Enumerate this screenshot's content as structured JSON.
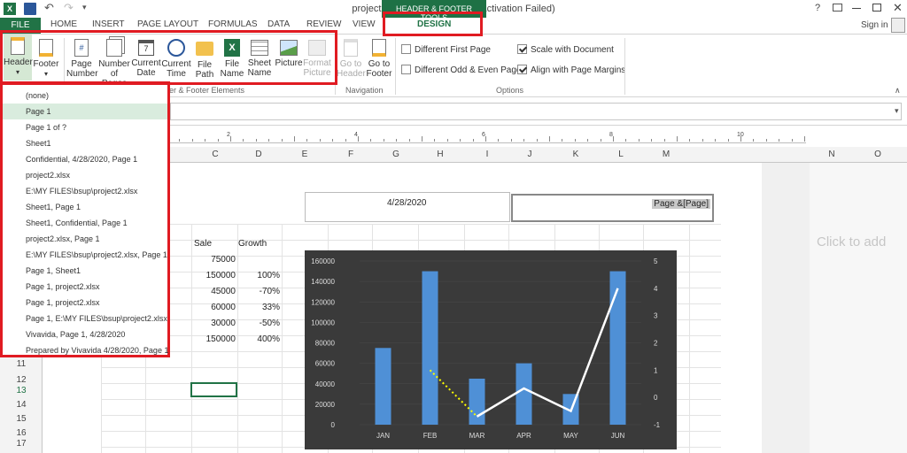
{
  "window": {
    "title": "project2.xlsx - Excel (Product Activation Failed)",
    "context_tools": "HEADER & FOOTER TOOLS",
    "help": "?",
    "sign_in": "Sign in"
  },
  "tabs": [
    "FILE",
    "HOME",
    "INSERT",
    "PAGE LAYOUT",
    "FORMULAS",
    "DATA",
    "REVIEW",
    "VIEW",
    "DESIGN"
  ],
  "ribbon": {
    "header_footer_group": {
      "header": "Header",
      "footer": "Footer"
    },
    "elements_group": {
      "label": "Header & Footer Elements",
      "buttons": [
        {
          "line1": "Page",
          "line2": "Number",
          "icon": "page-number-icon"
        },
        {
          "line1": "Number",
          "line2": "of Pages",
          "icon": "number-of-pages-icon"
        },
        {
          "line1": "Current",
          "line2": "Date",
          "icon": "calendar-icon"
        },
        {
          "line1": "Current",
          "line2": "Time",
          "icon": "clock-icon"
        },
        {
          "line1": "File",
          "line2": "Path",
          "icon": "folder-icon"
        },
        {
          "line1": "File",
          "line2": "Name",
          "icon": "excel-file-icon"
        },
        {
          "line1": "Sheet",
          "line2": "Name",
          "icon": "sheet-icon"
        },
        {
          "line1": "Picture",
          "line2": "",
          "icon": "picture-icon"
        },
        {
          "line1": "Format",
          "line2": "Picture",
          "icon": "format-picture-icon"
        }
      ],
      "visible_label": "er & Footer Elements"
    },
    "navigation_group": {
      "label": "Navigation",
      "buttons": [
        {
          "line1": "Go to",
          "line2": "Header"
        },
        {
          "line1": "Go to",
          "line2": "Footer"
        }
      ]
    },
    "options_group": {
      "label": "Options",
      "options": [
        {
          "label": "Different First Page",
          "checked": false
        },
        {
          "label": "Different Odd & Even Pages",
          "checked": false
        },
        {
          "label": "Scale with Document",
          "checked": true
        },
        {
          "label": "Align with Page Margins",
          "checked": true
        }
      ]
    }
  },
  "header_dropdown": {
    "items": [
      "(none)",
      "Page 1",
      "Page 1 of ?",
      "Sheet1",
      "Confidential, 4/28/2020, Page 1",
      "project2.xlsx",
      "E:\\MY FILES\\bsup\\project2.xlsx",
      "Sheet1, Page 1",
      "Sheet1,  Confidential, Page 1",
      "project2.xlsx, Page 1",
      "E:\\MY FILES\\bsup\\project2.xlsx, Page 1",
      "Page 1, Sheet1",
      "Page 1, project2.xlsx",
      "Page 1, project2.xlsx",
      "Page 1, E:\\MY FILES\\bsup\\project2.xlsx",
      "Vivavida, Page 1, 4/28/2020",
      "Prepared by Vivavida 4/28/2020, Page 1"
    ],
    "selected_index": 1
  },
  "ruler": {
    "numbers": [
      "2",
      "4",
      "6",
      "8",
      "10"
    ]
  },
  "columns": [
    "C",
    "D",
    "E",
    "F",
    "G",
    "H",
    "I",
    "J",
    "K",
    "L",
    "M",
    "N",
    "O"
  ],
  "rows": [
    "11",
    "12",
    "13",
    "14",
    "15",
    "16",
    "17"
  ],
  "page_header": {
    "center": "4/28/2020",
    "right": "Page &[Page]"
  },
  "next_page_prompt": "Click to add",
  "table": {
    "headers": [
      "Sale",
      "Growth"
    ],
    "rows": [
      {
        "sale": "75000",
        "growth": ""
      },
      {
        "sale": "150000",
        "growth": "100%"
      },
      {
        "sale": "45000",
        "growth": "-70%"
      },
      {
        "sale": "60000",
        "growth": "33%"
      },
      {
        "sale": "30000",
        "growth": "-50%"
      },
      {
        "sale": "150000",
        "growth": "400%"
      }
    ]
  },
  "chart_data": {
    "type": "bar",
    "categories": [
      "JAN",
      "FEB",
      "MAR",
      "APR",
      "MAY",
      "JUN"
    ],
    "series": [
      {
        "type": "bar",
        "values": [
          75000,
          150000,
          45000,
          60000,
          30000,
          150000
        ],
        "color": "#4f90d6"
      },
      {
        "type": "line",
        "values": [
          null,
          1,
          -0.7,
          0.33,
          -0.5,
          4
        ],
        "color": "#ffffff",
        "axis": "right"
      }
    ],
    "ylim": [
      0,
      160000
    ],
    "y_ticks": [
      "0",
      "20000",
      "40000",
      "60000",
      "80000",
      "100000",
      "120000",
      "140000",
      "160000"
    ],
    "y2lim": [
      -1,
      5
    ],
    "y2_ticks": [
      "-1",
      "0",
      "1",
      "2",
      "3",
      "4",
      "5"
    ],
    "trendline_color": "#ffff00",
    "background": "#3a3a3a"
  }
}
